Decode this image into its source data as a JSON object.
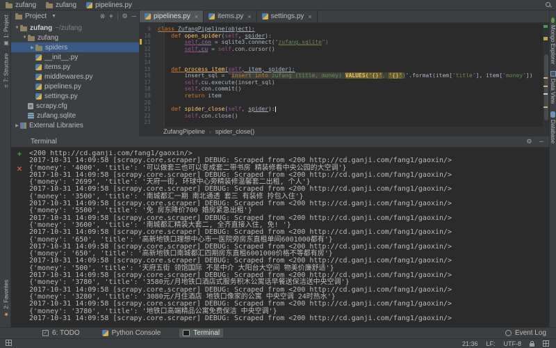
{
  "titlebar": {
    "path": [
      {
        "icon": "folder",
        "label": "zufang"
      },
      {
        "icon": "folder",
        "label": "zufang"
      },
      {
        "icon": "python",
        "label": "pipelines.py"
      }
    ]
  },
  "left_stripe": {
    "top": [
      {
        "icon": "project",
        "label": "1: Project"
      },
      {
        "icon": "structure",
        "label": "7: Structure"
      }
    ],
    "bottom": [
      {
        "icon": "star",
        "label": "2: Favorites"
      }
    ]
  },
  "right_stripe": [
    {
      "icon": "mongo",
      "label": "Mongo Explorer"
    },
    {
      "icon": "table",
      "label": "Data View"
    },
    {
      "icon": "db",
      "label": "Database"
    }
  ],
  "project": {
    "header": {
      "title": "Project",
      "icons": [
        "circle-cross",
        "plus-target",
        "divider",
        "gear",
        "hide"
      ]
    },
    "tree": [
      {
        "indent": 0,
        "arrow": "down",
        "icon": "folder",
        "label": "zufang",
        "extra": "~/zufang",
        "bold": true
      },
      {
        "indent": 1,
        "arrow": "down",
        "icon": "folder",
        "label": "zufang"
      },
      {
        "indent": 2,
        "arrow": "right",
        "icon": "folder",
        "label": "spiders",
        "selected": true
      },
      {
        "indent": 2,
        "arrow": "",
        "icon": "python",
        "label": "__init__.py"
      },
      {
        "indent": 2,
        "arrow": "",
        "icon": "python",
        "label": "items.py"
      },
      {
        "indent": 2,
        "arrow": "",
        "icon": "python",
        "label": "middlewares.py"
      },
      {
        "indent": 2,
        "arrow": "",
        "icon": "python",
        "label": "pipelines.py"
      },
      {
        "indent": 2,
        "arrow": "",
        "icon": "python",
        "label": "settings.py"
      },
      {
        "indent": 1,
        "arrow": "",
        "icon": "config",
        "label": "scrapy.cfg"
      },
      {
        "indent": 1,
        "arrow": "",
        "icon": "sqlite",
        "label": "zufang.sqlite"
      },
      {
        "indent": 0,
        "arrow": "right",
        "icon": "library",
        "label": "External Libraries"
      }
    ]
  },
  "editor": {
    "tabs": [
      {
        "label": "pipelines.py",
        "active": true
      },
      {
        "label": "items.py",
        "active": false
      },
      {
        "label": "settings.py",
        "active": false
      }
    ],
    "lines": [
      {
        "num": 9,
        "tokens": [
          [
            "kw u",
            "class "
          ],
          [
            "def u",
            "ZufangPipeline("
          ],
          [
            "def u",
            "object"
          ],
          [
            "def u",
            "):"
          ]
        ]
      },
      {
        "num": 10,
        "tokens": [
          [
            "def",
            "    "
          ],
          [
            "kw",
            "def "
          ],
          [
            "fn",
            "open_spider"
          ],
          [
            "def",
            "("
          ],
          [
            "self",
            "self"
          ],
          [
            "def",
            ", "
          ],
          [
            "param",
            "spider"
          ],
          [
            "def",
            "):"
          ]
        ]
      },
      {
        "num": 11,
        "tokens": [
          [
            "def",
            "        "
          ],
          [
            "self u",
            "self"
          ],
          [
            "attr u",
            ".con"
          ],
          [
            "def",
            " = sqlite3.connect("
          ],
          [
            "str",
            "\""
          ],
          [
            "str u",
            "zufang.sqlite"
          ],
          [
            "str",
            "\")"
          ]
        ]
      },
      {
        "num": 12,
        "tokens": [
          [
            "def",
            "        "
          ],
          [
            "self u",
            "self"
          ],
          [
            "attr u",
            ".cu"
          ],
          [
            "def",
            " = "
          ],
          [
            "self",
            "self"
          ],
          [
            "def",
            ".con.cursor()"
          ]
        ]
      },
      {
        "num": 13,
        "tokens": []
      },
      {
        "num": 14,
        "tokens": []
      },
      {
        "num": 15,
        "tokens": [
          [
            "def",
            "    "
          ],
          [
            "kw u",
            "def "
          ],
          [
            "fn u",
            "process_item"
          ],
          [
            "def u",
            "("
          ],
          [
            "self u",
            "self"
          ],
          [
            "def u",
            ", item, "
          ],
          [
            "param u",
            "spider"
          ],
          [
            "def u",
            "):"
          ]
        ]
      },
      {
        "num": 16,
        "tokens": [
          [
            "def",
            "        insert_sql = "
          ],
          [
            "str",
            "\""
          ],
          [
            "sqlkw",
            "insert into"
          ],
          [
            "sqlb",
            " zufang (title, money) "
          ],
          [
            "sqlhlkw",
            "VALUES("
          ],
          [
            "sqlhl",
            "'{}'"
          ],
          [
            "sqlb",
            ", "
          ],
          [
            "sqlhl",
            "'{}'"
          ],
          [
            "sqlb",
            ")"
          ],
          [
            "str",
            "\""
          ],
          [
            "def",
            ".format(item["
          ],
          [
            "str",
            "'title'"
          ],
          [
            "def",
            "], item["
          ],
          [
            "str",
            "'money'"
          ],
          [
            "def",
            "])"
          ]
        ]
      },
      {
        "num": 17,
        "tokens": [
          [
            "def",
            "        "
          ],
          [
            "self",
            "self"
          ],
          [
            "def",
            ".cu.execute(insert_sql)"
          ]
        ]
      },
      {
        "num": 18,
        "tokens": [
          [
            "def",
            "        "
          ],
          [
            "self",
            "self"
          ],
          [
            "def",
            ".con.commit()"
          ]
        ]
      },
      {
        "num": 19,
        "tokens": [
          [
            "def",
            "        "
          ],
          [
            "kw",
            "return"
          ],
          [
            "def",
            " item"
          ]
        ]
      },
      {
        "num": 20,
        "tokens": []
      },
      {
        "num": 21,
        "tokens": [
          [
            "def",
            "    "
          ],
          [
            "kw",
            "def "
          ],
          [
            "fn",
            "spider_close"
          ],
          [
            "def",
            "("
          ],
          [
            "self",
            "self"
          ],
          [
            "def",
            ", "
          ],
          [
            "param",
            "spider"
          ],
          [
            "def",
            "):"
          ],
          [
            "caret",
            ""
          ]
        ]
      },
      {
        "num": 22,
        "tokens": [
          [
            "def",
            "        "
          ],
          [
            "self",
            "self"
          ],
          [
            "def",
            ".con.close()"
          ]
        ]
      },
      {
        "num": 23,
        "tokens": []
      }
    ],
    "breadcrumb": [
      "ZufangPipeline",
      "spider_close()"
    ]
  },
  "terminal": {
    "title": "Terminal",
    "header_icons": [
      "gear",
      "hide"
    ],
    "lines": [
      "<200 http://cd.ganji.com/fang1/gaoxin/>",
      "2017-10-31 14:09:58 [scrapy.core.scraper] DEBUG: Scraped from <200 http://cd.ganji.com/fang1/gaoxin/>",
      "{'money': '4000', 'title': '可以做套三也可以变成套二带书房 精装修看中央公园的大空调'}",
      "2017-10-31 14:09:58 [scrapy.core.scraper] DEBUG: Scraped from <200 http://cd.ganji.com/fang1/gaoxin/>",
      "{'money': '2699', 'title': '天府一街, 环球中心旁精装修温馨套二出租, 个人'}",
      "2017-10-31 14:09:58 [scrapy.core.scraper] DEBUG: Scraped from <200 http://cd.ganji.com/fang1/gaoxin/>",
      "{'money': '3500', 'title': '南城都汇一期 南北通透 套三 有装修 拎包入住'}",
      "2017-10-31 14:09:58 [scrapy.core.scraper] DEBUG: Scraped from <200 http://cd.ganji.com/fang1/gaoxin/>",
      "{'money': '5500', 'title': '免 房东降价700 婚房紧急出租'}",
      "2017-10-31 14:09:58 [scrapy.core.scraper] DEBUG: Scraped from <200 http://cd.ganji.com/fang1/gaoxin/>",
      "{'money': '3600', 'title': '南城都汇精装大套二, 全齐直接入住, 免! '}",
      "2017-10-31 14:09:58 [scrapy.core.scraper] DEBUG: Scraped from <200 http://cd.ganji.com/fang1/gaoxin/>",
      "{'money': '650', 'title': '高新地铁口理想中心市一医院旁房东直租单间6001000都有'}",
      "2017-10-31 14:09:58 [scrapy.core.scraper] DEBUG: Scraped from <200 http://cd.ganji.com/fang1/gaoxin/>",
      "{'money': '650', 'title': '高新地铁口南城都汇四期房东直租6001000价格不等都有房'}",
      "2017-10-31 14:09:58 [scrapy.core.scraper] DEBUG: Scraped from <200 http://cd.ganji.com/fang1/gaoxin/>",
      "{'money': '500', 'title': '天府五街 领馆国际 不是中介 大阳台大空间 物美价廉舒适'}",
      "2017-10-31 14:09:58 [scrapy.core.scraper] DEBUG: Scraped from <200 http://cd.ganji.com/fang1/gaoxin/>",
      "{'money': '3780', 'title': '3580元/月地铁口酒店式服务积木公寓话早餐送保洁送中央空调'}",
      "2017-10-31 14:09:58 [scrapy.core.scraper] DEBUG: Scraped from <200 http://cd.ganji.com/fang1/gaoxin/>",
      "{'money': '3280', 'title': '3080元/月住酒店 地铁口像家的公寓 中央空调 24时热水'}",
      "2017-10-31 14:09:58 [scrapy.core.scraper] DEBUG: Scraped from <200 http://cd.ganji.com/fang1/gaoxin/>",
      "{'money': '3780', 'title': '地铁口高端精品公寓免费保洁 中央空调'}",
      "2017-10-31 14:09:58 [scrapy.core.scraper] DEBUG: Scraped from <200 http://cd.ganji.com/fang1/gaoxin/>"
    ]
  },
  "bottom_bar": {
    "left": [
      {
        "icon": "todo",
        "label": "6: TODO",
        "active": false
      },
      {
        "icon": "python",
        "label": "Python Console",
        "active": false
      },
      {
        "icon": "terminal",
        "label": "Terminal",
        "active": true
      }
    ],
    "right": {
      "icon": "event",
      "label": "Event Log"
    }
  },
  "status_bar": {
    "caret_position": "21:36",
    "line_separator": "LF:",
    "encoding": "UTF-8"
  },
  "colors": {
    "selection": "#3a5a86",
    "keyword": "#cc7832",
    "string": "#6a8759",
    "function": "#ffc66d",
    "background_editor": "#2b2b2b",
    "background_panel": "#3c3f41"
  }
}
